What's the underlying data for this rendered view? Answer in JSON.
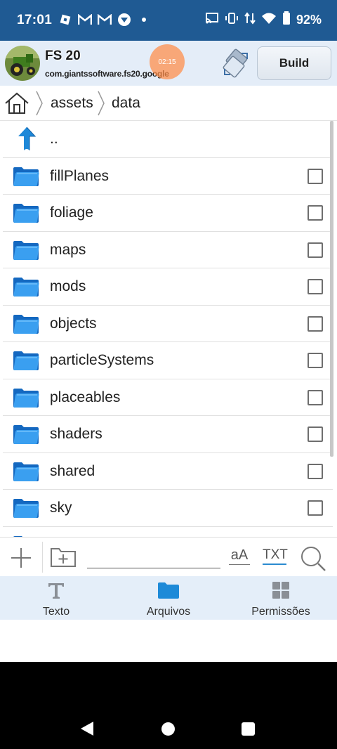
{
  "status_bar": {
    "time": "17:01",
    "battery_percent": "92%",
    "left_icons": [
      "roblox-icon",
      "gmail-icon",
      "gmail-icon",
      "app-icon",
      "dot-icon"
    ],
    "right_icons": [
      "cast-icon",
      "vibrate-icon",
      "data-arrows-icon",
      "wifi-icon",
      "battery-icon"
    ]
  },
  "app": {
    "name": "FS 20",
    "package": "com.giantssoftware.fs20.google",
    "recording_time": "02:15",
    "build_label": "Build"
  },
  "breadcrumb": {
    "items": [
      "assets",
      "data"
    ]
  },
  "files": {
    "parent_label": "..",
    "items": [
      {
        "name": "fillPlanes"
      },
      {
        "name": "foliage"
      },
      {
        "name": "maps"
      },
      {
        "name": "mods"
      },
      {
        "name": "objects"
      },
      {
        "name": "particleSystems"
      },
      {
        "name": "placeables"
      },
      {
        "name": "shaders"
      },
      {
        "name": "shared"
      },
      {
        "name": "sky"
      }
    ]
  },
  "toolbar": {
    "search_value": "",
    "font_toggle_label": "aA",
    "txt_label": "TXT"
  },
  "tabs": [
    {
      "label": "Texto",
      "icon": "text-t-icon"
    },
    {
      "label": "Arquivos",
      "icon": "folder-icon",
      "active": true
    },
    {
      "label": "Permissões",
      "icon": "grid-icon"
    }
  ],
  "colors": {
    "status_bar": "#1f5a93",
    "header_bg": "#e4edf8",
    "folder_blue": "#2c8fe6",
    "accent": "#1d8ad8"
  }
}
